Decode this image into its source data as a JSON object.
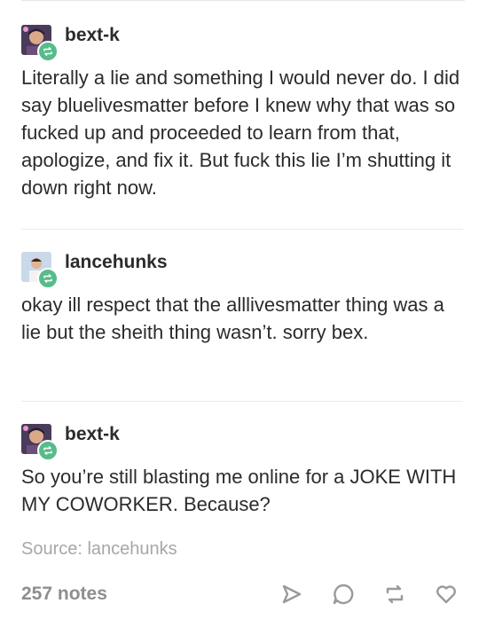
{
  "posts": [
    {
      "username": "bext-k",
      "text": "Literally a lie and something I would never do. I did say bluelivesmatter before I knew why that was so fucked up and proceeded to learn from that, apologize, and fix it. But fuck this lie I’m shutting it down right now."
    },
    {
      "username": "lancehunks",
      "text": "okay ill respect that the alllivesmatter thing was a lie but the sheith thing wasn’t. sorry bex."
    },
    {
      "username": "bext-k",
      "text": "So you’re still blasting me online for a JOKE WITH MY COWORKER. Because?"
    }
  ],
  "source": "Source: lancehunks",
  "footer": {
    "notes": "257 notes",
    "actions": [
      "share-icon",
      "reply-icon",
      "reblog-icon",
      "like-icon"
    ]
  },
  "colors": {
    "reblog_badge": "#56bc8a",
    "text": "#2b2b2b",
    "muted": "#a7a7a7"
  }
}
